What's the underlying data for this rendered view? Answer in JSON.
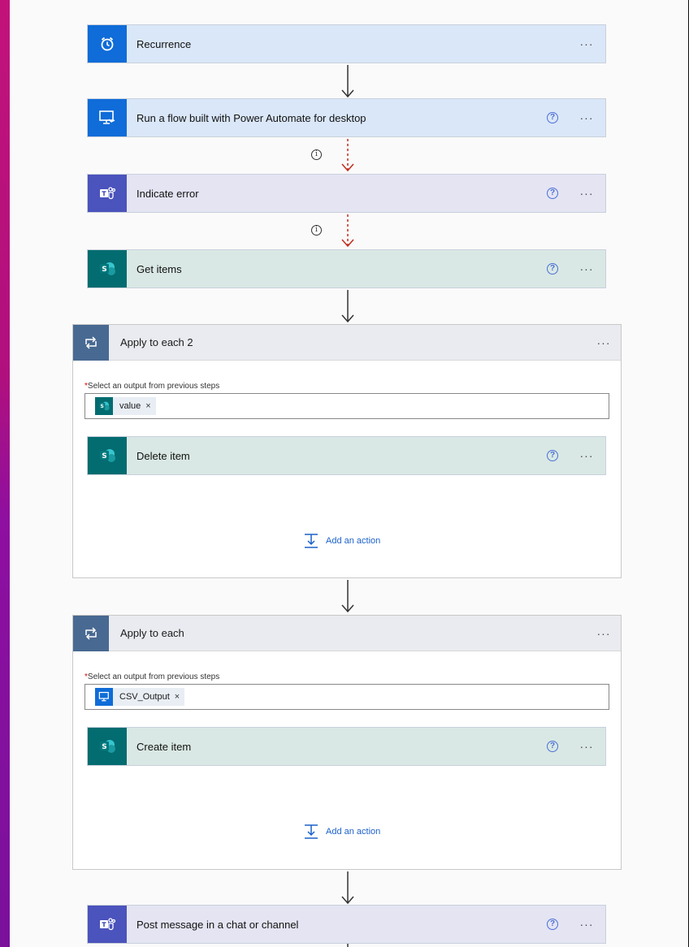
{
  "steps": {
    "recurrence": {
      "title": "Recurrence",
      "more": "···"
    },
    "run_flow": {
      "title": "Run a flow built with Power Automate for desktop",
      "help": "?",
      "more": "···"
    },
    "indicate_error": {
      "title": "Indicate error",
      "help": "?",
      "more": "···"
    },
    "get_items": {
      "title": "Get items",
      "help": "?",
      "more": "···"
    },
    "apply_each_2": {
      "title": "Apply to each 2",
      "more": "···",
      "select_label": "Select an output from previous steps",
      "required_mark": "*",
      "token": "value",
      "token_remove": "×",
      "inner": {
        "title": "Delete item",
        "help": "?",
        "more": "···"
      },
      "add_action": "Add an action"
    },
    "apply_each": {
      "title": "Apply to each",
      "more": "···",
      "select_label": "Select an output from previous steps",
      "required_mark": "*",
      "token": "CSV_Output",
      "token_remove": "×",
      "inner": {
        "title": "Create item",
        "help": "?",
        "more": "···"
      },
      "add_action": "Add an action"
    },
    "post_message": {
      "title": "Post message in a chat or channel",
      "help": "?",
      "more": "···"
    }
  },
  "info_glyph": "i",
  "colors": {
    "powerautomate_blue": "#0f6cd8",
    "teams_purple": "#4b53bc",
    "sharepoint_teal": "#036c70",
    "loop_header": "#486991",
    "error_arrow": "#c42b1c",
    "link": "#1b61c9"
  },
  "icons": {
    "recurrence": "alarm-clock-icon",
    "run_flow": "desktop-flow-icon",
    "teams": "teams-icon",
    "sharepoint": "sharepoint-icon",
    "loop": "loop-icon",
    "add_action": "add-action-icon"
  }
}
